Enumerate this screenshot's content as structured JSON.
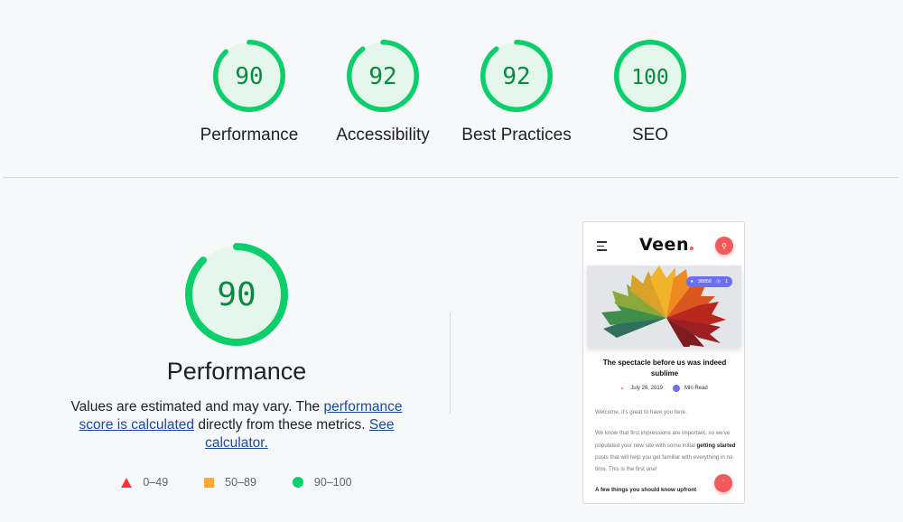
{
  "colors": {
    "pass": "#0cce6b",
    "pass_text": "#0a8a3f",
    "pass_fill": "#e5f7ec",
    "average": "#ffaa33",
    "fail": "#ff3333",
    "link": "#1a4aa3"
  },
  "categories": [
    {
      "label": "Performance",
      "score": 90
    },
    {
      "label": "Accessibility",
      "score": 92
    },
    {
      "label": "Best Practices",
      "score": 92
    },
    {
      "label": "SEO",
      "score": 100
    }
  ],
  "performance": {
    "score": 90,
    "title": "Performance",
    "desc_prefix": "Values are estimated and may vary. The ",
    "desc_link1": "performance score is calculated",
    "desc_middle": " directly from these metrics. ",
    "desc_link2": "See calculator."
  },
  "legend": [
    {
      "shape": "triangle-icon",
      "range": "0–49"
    },
    {
      "shape": "square-icon",
      "range": "50–89"
    },
    {
      "shape": "circle-icon",
      "range": "90–100"
    }
  ],
  "screenshot": {
    "logo": "Veen",
    "views": "38856",
    "read_minutes": "1",
    "post_title": "The spectacle before us was indeed sublime",
    "date": "July 26, 2019",
    "read_label": "Min Read",
    "para1": "Welcome, it's great to have you here.",
    "para2_a": "We know that first impressions are important, so we've populated your new site with some initial ",
    "para2_bold": "getting started",
    "para2_b": " posts that will help you get familiar with everything in no time. This is the first one!",
    "para3": "A few things you should know upfront"
  }
}
